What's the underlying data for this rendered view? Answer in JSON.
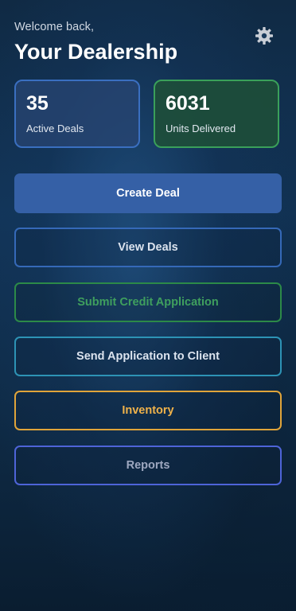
{
  "header": {
    "welcome": "Welcome back,",
    "title": "Your Dealership"
  },
  "settings": {
    "icon": "gear-icon"
  },
  "stats": [
    {
      "value": "35",
      "label": "Active Deals",
      "color": "#3a6fc0"
    },
    {
      "value": "6031",
      "label": "Units Delivered",
      "color": "#3aa05a"
    }
  ],
  "actions": {
    "create_deal": "Create Deal",
    "view_deals": "View Deals",
    "submit_credit": "Submit Credit Application",
    "send_application": "Send Application to Client",
    "inventory": "Inventory",
    "reports": "Reports"
  },
  "colors": {
    "primary": "#3560a6",
    "green": "#3aa05a",
    "teal": "#2d93b5",
    "orange": "#e0a43a",
    "indigo": "#4e64d8"
  }
}
